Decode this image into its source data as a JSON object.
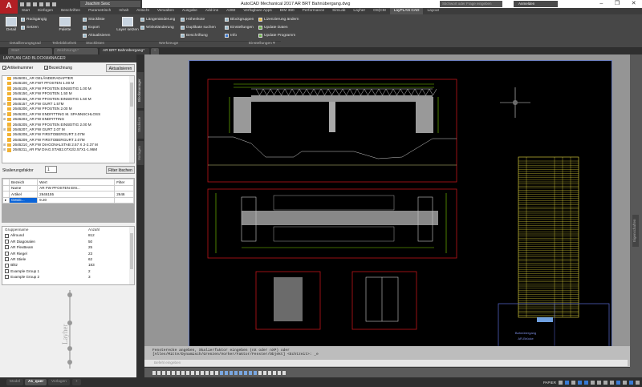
{
  "app": {
    "title": "AutoCAD Mechanical 2017   AR BRT Bahnübergang.dwg",
    "user": "Joachim Sesc",
    "search_placeholder": "Stichwort oder Frage eingeben",
    "signin": "Anmelden"
  },
  "ribbon_tabs": [
    "Start",
    "Einfügen",
    "Beschriften",
    "Parametrisch",
    "Inhalt",
    "Ansicht",
    "Verwalten",
    "Ausgabe",
    "Add-ins",
    "A360",
    "Verfügbare Apps",
    "BIM 360",
    "Performance",
    "SimLab",
    "Layher",
    "OS|CM",
    "LayPLAN CAD",
    "Layout"
  ],
  "ribbon_active_tab": "LayPLAN CAD",
  "ribbon": {
    "detail": "Detail",
    "rueckgaengig": "Rückgängig",
    "setzen": "Setzen",
    "palette": "Palette",
    "stueckliste": "Stückliste",
    "export": "Export",
    "aktualisieren": "Aktualisieren",
    "layer_setzen": "Layer setzen",
    "laengenaenderung": "Längenänderung",
    "winkelaenderung": "Winkeländerung",
    "hoehenkote": "Höhenkote",
    "duplikate": "Duplikate suchen",
    "beschriftung": "Beschriftung",
    "blockgruppen": "Blockgruppen",
    "einstellungen": "Einstellungen",
    "info": "Info",
    "lizenzierung": "Lizenzierung ändern",
    "update_daten": "Update Daten",
    "update_programm": "Update Programm",
    "panels": [
      "Detaillierungsgrad",
      "Teilebibliothek",
      "Stücklisten",
      "Werkzeuge",
      "Einstellungen ▾"
    ]
  },
  "doc_tabs": [
    "Start",
    "Zeichnung1*",
    "AR BRT Bahnübergang*"
  ],
  "blockmanager": {
    "title": "LAYPLAN CAD BLOCKMANAGER",
    "chk_artikel": "Artikelnummer",
    "chk_bezeichnung": "Bezeichnung",
    "refresh": "Aktualisieren",
    "items": [
      "2646001_AR GELÄNDERADAPTER",
      "2646100_AR FWT PFOSTEN 1.00 M",
      "2646105_AR FW PFOSTEN EINSEITIG 1.00 M",
      "2646150_AR FW PFOSTEN 1.50 M",
      "2646155_AR FW PFOSTEN EINSEITIG 1.50 M",
      "2646157_AR FW GURT 1.57M",
      "2646200_AR FW PFOSTEN 2.00 M",
      "2646202_AR FW ENDFITTING M. SPANNSCHLOSS",
      "2646203_AR FW ENDFITTING",
      "2646205_AR FW PFOSTEN EINSEITIG 2.00 M",
      "2646207_AR FW GURT 2.07 M",
      "2646208_AR FW FIRSTOBERGURT 2.07M",
      "2646209_AR FW FIRSTOBERGURT 2.07M",
      "2646210_AR FW DIAGONALSTAB 2.57 X 2-2.37 M",
      "2646211_AR FW DIAG.STAB2.07X2/2.57X1-1.96M"
    ],
    "expandable": [
      5,
      7,
      8,
      10,
      13,
      14
    ],
    "scale_label": "Skalierungsfaktor",
    "scale_value": "1",
    "filter_clear": "Filter löschen",
    "grid_headers": [
      "Bezeich",
      "Wert",
      "Filter"
    ],
    "grid_rows": [
      [
        "Name",
        "AR FW PFOSTEN EIN...",
        ""
      ],
      [
        "Artikel",
        "2646155",
        "2646"
      ],
      [
        "Gewic...",
        "9.20",
        ""
      ]
    ],
    "group_headers": [
      "Gruppenname",
      "Anzahl"
    ],
    "groups": [
      [
        "Allround",
        "812"
      ],
      [
        "AR Diagonalen",
        "50"
      ],
      [
        "AR FlexBeam",
        "25"
      ],
      [
        "AR Riegel",
        "23"
      ],
      [
        "AR Stiele",
        "62"
      ],
      [
        "Blitz",
        "183"
      ],
      [
        "Example Group 1",
        "2"
      ],
      [
        "Example Group 2",
        "3"
      ]
    ],
    "logo": "Layher"
  },
  "side_tabs": [
    "Blockmanager",
    "Stückliste",
    "Vorlagen"
  ],
  "right_tab": "Eigenschaften",
  "command": {
    "line1": "Fensterecke angeben, Skalierfaktor eingeben (nX oder nXP) oder",
    "line2": "[Alles/Mitte/Dynamisch/Grenzen/Vorher/Faktor/Fenster/Objekt] <Echtzeit>: _e",
    "placeholder": "Befehl eingeben"
  },
  "layout_tabs": [
    "Model",
    "A1_quer",
    "Vorlagen",
    "+"
  ],
  "active_layout": "A1_quer",
  "status": {
    "space": "PAPIER"
  },
  "drawing": {
    "title_block": "Bahnübergang",
    "subtitle": "AR-Brücke",
    "logo": "Layher"
  },
  "colors": {
    "accent": "#b21f24",
    "paper": "#000000",
    "frame": "#c0141b",
    "dimension": "#7fd400",
    "table": "#f0e442"
  }
}
